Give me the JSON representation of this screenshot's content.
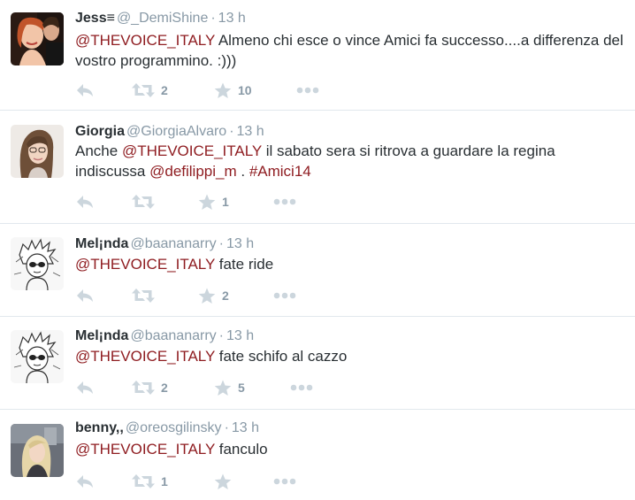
{
  "tweets": [
    {
      "fullname": "Jess≡",
      "username": "@_DemiShine",
      "time": "13 h",
      "text": [
        {
          "type": "mention",
          "value": "@THEVOICE_ITALY"
        },
        {
          "type": "text",
          "value": " Almeno chi esce o vince Amici fa successo....a differenza del vostro programmino. :)))"
        }
      ],
      "retweets": "2",
      "favorites": "10"
    },
    {
      "fullname": "Giorgia",
      "username": "@GiorgiaAlvaro",
      "time": "13 h",
      "text": [
        {
          "type": "text",
          "value": "Anche "
        },
        {
          "type": "mention",
          "value": "@THEVOICE_ITALY"
        },
        {
          "type": "text",
          "value": " il sabato sera si ritrova a guardare la regina indiscussa "
        },
        {
          "type": "mention",
          "value": "@defilippi_m"
        },
        {
          "type": "text",
          "value": " . "
        },
        {
          "type": "hashtag",
          "value": "#Amici14"
        }
      ],
      "retweets": "",
      "favorites": "1"
    },
    {
      "fullname": "Mel¡nda",
      "username": "@baananarry",
      "time": "13 h",
      "text": [
        {
          "type": "mention",
          "value": "@THEVOICE_ITALY"
        },
        {
          "type": "text",
          "value": " fate ride"
        }
      ],
      "retweets": "",
      "favorites": "2"
    },
    {
      "fullname": "Mel¡nda",
      "username": "@baananarry",
      "time": "13 h",
      "text": [
        {
          "type": "mention",
          "value": "@THEVOICE_ITALY"
        },
        {
          "type": "text",
          "value": " fate schifo al cazzo"
        }
      ],
      "retweets": "2",
      "favorites": "5"
    },
    {
      "fullname": "benny,,",
      "username": "@oreosgilinsky",
      "time": "13 h",
      "text": [
        {
          "type": "mention",
          "value": "@THEVOICE_ITALY"
        },
        {
          "type": "text",
          "value": " fanculo"
        }
      ],
      "retweets": "1",
      "favorites": ""
    }
  ],
  "icons": {
    "reply": "reply-icon",
    "retweet": "retweet-icon",
    "favorite": "star-icon",
    "more": "more-icon"
  },
  "colors": {
    "link": "#8f1d21",
    "secondary_text": "#8899a6",
    "action_icon": "#ccd6dd",
    "divider": "#e1e8ed"
  }
}
